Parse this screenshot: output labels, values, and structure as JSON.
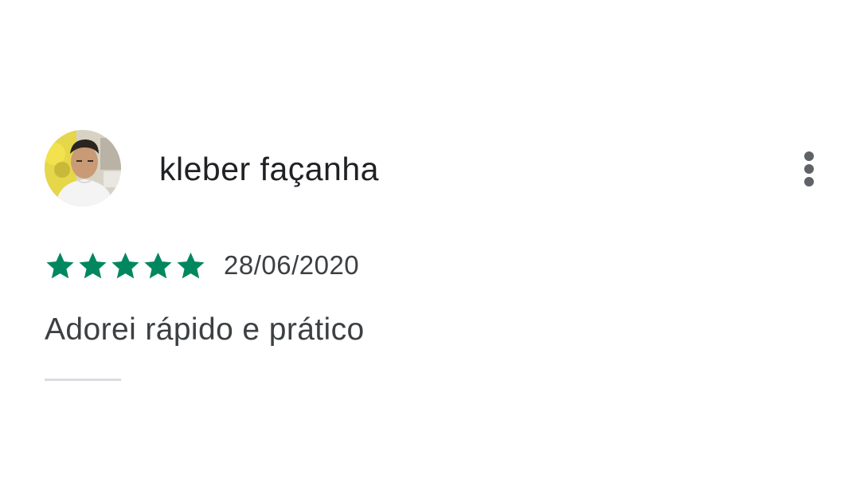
{
  "review": {
    "reviewer_name": "kleber façanha",
    "avatar_icon": "user-avatar-photo",
    "more_icon": "more-vert-icon",
    "rating": {
      "stars": 5,
      "max_stars": 5,
      "star_icon": "star-icon",
      "color": "#01875f"
    },
    "date": "28/06/2020",
    "text": "Adorei rápido e prático"
  },
  "colors": {
    "name_text": "#202124",
    "body_text": "#3c4043",
    "icon_gray": "#5f6368",
    "divider": "#dadce0",
    "star_green": "#01875f"
  }
}
